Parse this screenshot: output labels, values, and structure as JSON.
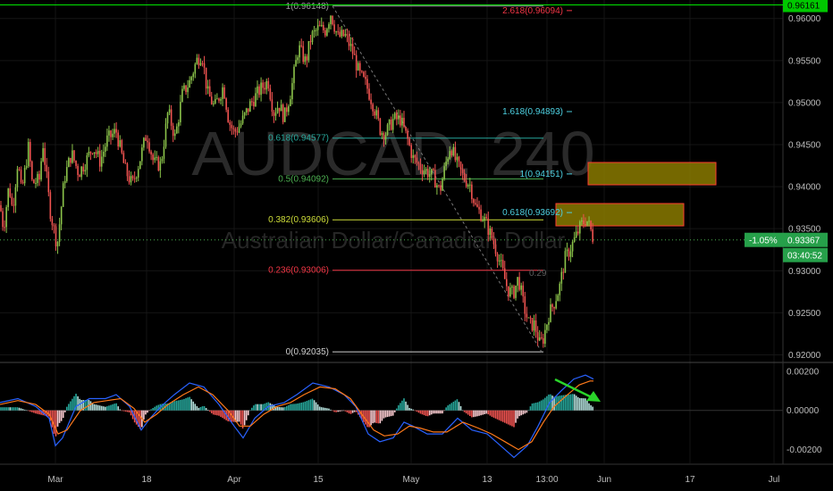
{
  "watermark": {
    "symbol": "AUDCAD, 240",
    "name": "Australian Dollar/Canadian Dollar"
  },
  "price_axis": {
    "ticks": [
      "0.96000",
      "0.95500",
      "0.95000",
      "0.94500",
      "0.94000",
      "0.93500",
      "0.93000",
      "0.92500",
      "0.92000"
    ]
  },
  "osc_axis": {
    "ticks": [
      "0.00200",
      "0.00000",
      "-0.00200"
    ]
  },
  "time_axis": {
    "labels": [
      "Mar",
      "18",
      "Apr",
      "15",
      "May",
      "13",
      "13:00",
      "Jun",
      "17",
      "Jul"
    ]
  },
  "tags": {
    "top_line": "0.96161",
    "last_change": "-1.05%",
    "last_price": "0.93367",
    "countdown": "03:40:52"
  },
  "fib_retracement": [
    {
      "label": "1(0.96148)",
      "value": 0.96148,
      "color": "#9e9e9e"
    },
    {
      "label": "0.618(0.94577)",
      "value": 0.94577,
      "color": "#26a69a"
    },
    {
      "label": "0.5(0.94092)",
      "value": 0.94092,
      "color": "#4caf50"
    },
    {
      "label": "0.382(0.93606)",
      "value": 0.93606,
      "color": "#cddc39"
    },
    {
      "label": "0.236(0.93006)",
      "value": 0.93006,
      "color": "#f23645"
    },
    {
      "label": "0(0.92035)",
      "value": 0.92035,
      "color": "#d0d0d0"
    }
  ],
  "fib_extension": [
    {
      "label": "2.618(0.96094)",
      "value": 0.96094,
      "color": "#f23645"
    },
    {
      "label": "1.618(0.94893)",
      "value": 0.94893,
      "color": "#4dd0e1"
    },
    {
      "label": "1(0.94151)",
      "value": 0.94151,
      "color": "#4dd0e1"
    },
    {
      "label": "0.618(0.93692)",
      "value": 0.93692,
      "color": "#4dd0e1"
    },
    {
      "label": "0.29",
      "value": 0.9297,
      "color": "#5e5e5e"
    }
  ],
  "colors": {
    "up": "#8bc34a",
    "down": "#ef5350",
    "macd": "#2962ff",
    "signal": "#ff7a1a",
    "zone": "#8a7a00",
    "zone_border": "#ff3b30",
    "hline": "#00e600",
    "arrow": "#2ad42a"
  },
  "chart_data": {
    "type": "candlestick",
    "symbol": "AUDCAD",
    "interval": "240",
    "price_range": [
      0.9192,
      0.9622
    ],
    "horizontal_line": 0.96161,
    "last_price": 0.93367,
    "close_path": [
      [
        0,
        0.9378
      ],
      [
        4,
        0.935
      ],
      [
        10,
        0.9402
      ],
      [
        14,
        0.9372
      ],
      [
        20,
        0.9432
      ],
      [
        24,
        0.9392
      ],
      [
        32,
        0.9448
      ],
      [
        36,
        0.9404
      ],
      [
        44,
        0.9408
      ],
      [
        48,
        0.9452
      ],
      [
        56,
        0.9372
      ],
      [
        64,
        0.933
      ],
      [
        72,
        0.941
      ],
      [
        80,
        0.944
      ],
      [
        88,
        0.9416
      ],
      [
        96,
        0.943
      ],
      [
        104,
        0.9448
      ],
      [
        112,
        0.943
      ],
      [
        120,
        0.9456
      ],
      [
        130,
        0.9466
      ],
      [
        140,
        0.942
      ],
      [
        148,
        0.9402
      ],
      [
        156,
        0.943
      ],
      [
        164,
        0.9464
      ],
      [
        172,
        0.9428
      ],
      [
        180,
        0.9426
      ],
      [
        188,
        0.949
      ],
      [
        196,
        0.9458
      ],
      [
        204,
        0.951
      ],
      [
        212,
        0.9524
      ],
      [
        220,
        0.955
      ],
      [
        226,
        0.9558
      ],
      [
        232,
        0.9512
      ],
      [
        240,
        0.9494
      ],
      [
        250,
        0.952
      ],
      [
        256,
        0.9478
      ],
      [
        262,
        0.9464
      ],
      [
        270,
        0.9476
      ],
      [
        280,
        0.9498
      ],
      [
        290,
        0.9514
      ],
      [
        300,
        0.9526
      ],
      [
        306,
        0.9488
      ],
      [
        312,
        0.9498
      ],
      [
        318,
        0.9482
      ],
      [
        326,
        0.9516
      ],
      [
        334,
        0.9566
      ],
      [
        342,
        0.9548
      ],
      [
        348,
        0.9578
      ],
      [
        356,
        0.9588
      ],
      [
        364,
        0.9586
      ],
      [
        370,
        0.9606
      ],
      [
        378,
        0.9578
      ],
      [
        386,
        0.958
      ],
      [
        394,
        0.9562
      ],
      [
        402,
        0.9534
      ],
      [
        410,
        0.952
      ],
      [
        418,
        0.9496
      ],
      [
        426,
        0.9466
      ],
      [
        432,
        0.9464
      ],
      [
        440,
        0.948
      ],
      [
        448,
        0.948
      ],
      [
        456,
        0.9456
      ],
      [
        462,
        0.9434
      ],
      [
        470,
        0.9424
      ],
      [
        478,
        0.9418
      ],
      [
        486,
        0.941
      ],
      [
        492,
        0.9394
      ],
      [
        498,
        0.9424
      ],
      [
        504,
        0.945
      ],
      [
        510,
        0.943
      ],
      [
        518,
        0.9412
      ],
      [
        526,
        0.9402
      ],
      [
        532,
        0.9376
      ],
      [
        538,
        0.9368
      ],
      [
        544,
        0.9356
      ],
      [
        550,
        0.934
      ],
      [
        556,
        0.9322
      ],
      [
        562,
        0.93
      ],
      [
        568,
        0.9278
      ],
      [
        574,
        0.9272
      ],
      [
        580,
        0.9292
      ],
      [
        586,
        0.9258
      ],
      [
        592,
        0.9236
      ],
      [
        598,
        0.9236
      ],
      [
        604,
        0.9212
      ],
      [
        608,
        0.922
      ],
      [
        614,
        0.9248
      ],
      [
        620,
        0.9262
      ],
      [
        626,
        0.928
      ],
      [
        632,
        0.9314
      ],
      [
        638,
        0.9326
      ],
      [
        644,
        0.934
      ],
      [
        650,
        0.9354
      ],
      [
        656,
        0.9362
      ],
      [
        661,
        0.9348
      ],
      [
        664,
        0.9337
      ]
    ],
    "macd_path": [
      [
        0,
        0.0004
      ],
      [
        20,
        0.0006
      ],
      [
        40,
        0.0002
      ],
      [
        55,
        -0.0004
      ],
      [
        62,
        -0.0018
      ],
      [
        70,
        -0.0014
      ],
      [
        85,
        0.0002
      ],
      [
        100,
        0.0006
      ],
      [
        118,
        0.0006
      ],
      [
        130,
        0.0008
      ],
      [
        145,
        0.0002
      ],
      [
        158,
        -0.001
      ],
      [
        168,
        -0.0004
      ],
      [
        180,
        0.0002
      ],
      [
        195,
        0.0008
      ],
      [
        212,
        0.0014
      ],
      [
        228,
        0.0012
      ],
      [
        245,
        0.0003
      ],
      [
        262,
        -0.0008
      ],
      [
        272,
        -0.0014
      ],
      [
        285,
        -0.0004
      ],
      [
        300,
        0.0002
      ],
      [
        318,
        0.0004
      ],
      [
        332,
        0.0008
      ],
      [
        350,
        0.0014
      ],
      [
        368,
        0.0012
      ],
      [
        385,
        0.0008
      ],
      [
        398,
        0.0002
      ],
      [
        412,
        -0.0012
      ],
      [
        425,
        -0.0016
      ],
      [
        440,
        -0.0014
      ],
      [
        452,
        -0.0006
      ],
      [
        462,
        -0.0008
      ],
      [
        478,
        -0.0012
      ],
      [
        495,
        -0.0012
      ],
      [
        512,
        -0.0004
      ],
      [
        528,
        -0.001
      ],
      [
        545,
        -0.0012
      ],
      [
        560,
        -0.0018
      ],
      [
        575,
        -0.0024
      ],
      [
        590,
        -0.0018
      ],
      [
        602,
        -0.0008
      ],
      [
        615,
        0.0004
      ],
      [
        628,
        0.001
      ],
      [
        642,
        0.0016
      ],
      [
        655,
        0.0018
      ],
      [
        664,
        0.0016
      ]
    ],
    "signal_path": [
      [
        0,
        0.0003
      ],
      [
        20,
        0.0005
      ],
      [
        40,
        0.0003
      ],
      [
        55,
        -0.0002
      ],
      [
        65,
        -0.0012
      ],
      [
        75,
        -0.001
      ],
      [
        90,
        0.0
      ],
      [
        105,
        0.0004
      ],
      [
        120,
        0.0005
      ],
      [
        135,
        0.0006
      ],
      [
        150,
        0.0001
      ],
      [
        162,
        -0.0006
      ],
      [
        175,
        -0.0002
      ],
      [
        188,
        0.0003
      ],
      [
        205,
        0.0008
      ],
      [
        222,
        0.0012
      ],
      [
        238,
        0.0008
      ],
      [
        255,
        0.0
      ],
      [
        268,
        -0.0008
      ],
      [
        280,
        -0.0008
      ],
      [
        295,
        -0.0002
      ],
      [
        310,
        0.0002
      ],
      [
        325,
        0.0004
      ],
      [
        340,
        0.0008
      ],
      [
        358,
        0.0012
      ],
      [
        375,
        0.0011
      ],
      [
        392,
        0.0006
      ],
      [
        405,
        -0.0002
      ],
      [
        418,
        -0.001
      ],
      [
        430,
        -0.0013
      ],
      [
        445,
        -0.0012
      ],
      [
        458,
        -0.0008
      ],
      [
        470,
        -0.0009
      ],
      [
        485,
        -0.0011
      ],
      [
        500,
        -0.0011
      ],
      [
        518,
        -0.0006
      ],
      [
        535,
        -0.0009
      ],
      [
        550,
        -0.0012
      ],
      [
        565,
        -0.0016
      ],
      [
        580,
        -0.002
      ],
      [
        595,
        -0.0016
      ],
      [
        608,
        -0.0006
      ],
      [
        620,
        0.0002
      ],
      [
        635,
        0.0008
      ],
      [
        648,
        0.0013
      ],
      [
        660,
        0.0015
      ],
      [
        664,
        0.0015
      ]
    ],
    "osc_range": [
      -0.0027,
      0.0024
    ]
  }
}
